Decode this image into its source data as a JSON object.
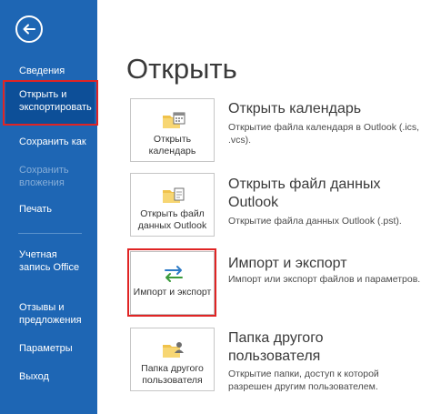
{
  "sidebar": {
    "back_label": "",
    "items": [
      {
        "label": "Сведения"
      },
      {
        "label": "Открыть и экспортировать"
      },
      {
        "label": "Сохранить как"
      },
      {
        "label": "Сохранить вложения"
      },
      {
        "label": "Печать"
      },
      {
        "label": "Учетная запись Office"
      },
      {
        "label": "Отзывы и предложения"
      },
      {
        "label": "Параметры"
      },
      {
        "label": "Выход"
      }
    ]
  },
  "main": {
    "title": "Открыть",
    "options": [
      {
        "tile_label": "Открыть календарь",
        "title": "Открыть календарь",
        "description": "Открытие файла календаря в Outlook (.ics, .vcs)."
      },
      {
        "tile_label": "Открыть файл данных Outlook",
        "title": "Открыть файл данных Outlook",
        "description": "Открытие файла данных Outlook (.pst)."
      },
      {
        "tile_label": "Импорт и экспорт",
        "title": "Импорт и экспорт",
        "description": "Импорт или экспорт файлов и параметров."
      },
      {
        "tile_label": "Папка другого пользователя",
        "title": "Папка другого пользователя",
        "description": "Открытие папки, доступ к которой разрешен другим пользователем."
      }
    ]
  },
  "colors": {
    "sidebar_bg": "#1e66b4",
    "sidebar_selected": "#0d4f98",
    "highlight_outline": "#e02424",
    "folder_yellow": "#f0c24b"
  }
}
